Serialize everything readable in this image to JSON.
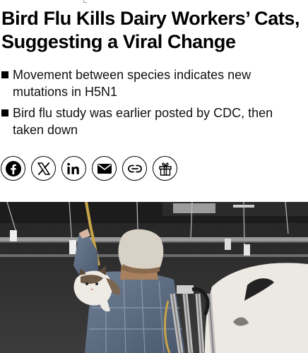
{
  "article": {
    "headline": "Bird Flu Kills Dairy Workers’ Cats, Suggesting a Viral Change",
    "bullets": [
      "Movement between species indicates new mutations in H5N1",
      "Bird flu study was earlier posted by CDC, then taken down"
    ]
  },
  "share": {
    "buttons": [
      {
        "icon": "facebook-icon"
      },
      {
        "icon": "x-icon"
      },
      {
        "icon": "linkedin-icon"
      },
      {
        "icon": "email-icon"
      },
      {
        "icon": "link-icon"
      },
      {
        "icon": "gift-icon"
      }
    ]
  },
  "colors": {
    "text": "#000000",
    "background": "#ffffff"
  }
}
